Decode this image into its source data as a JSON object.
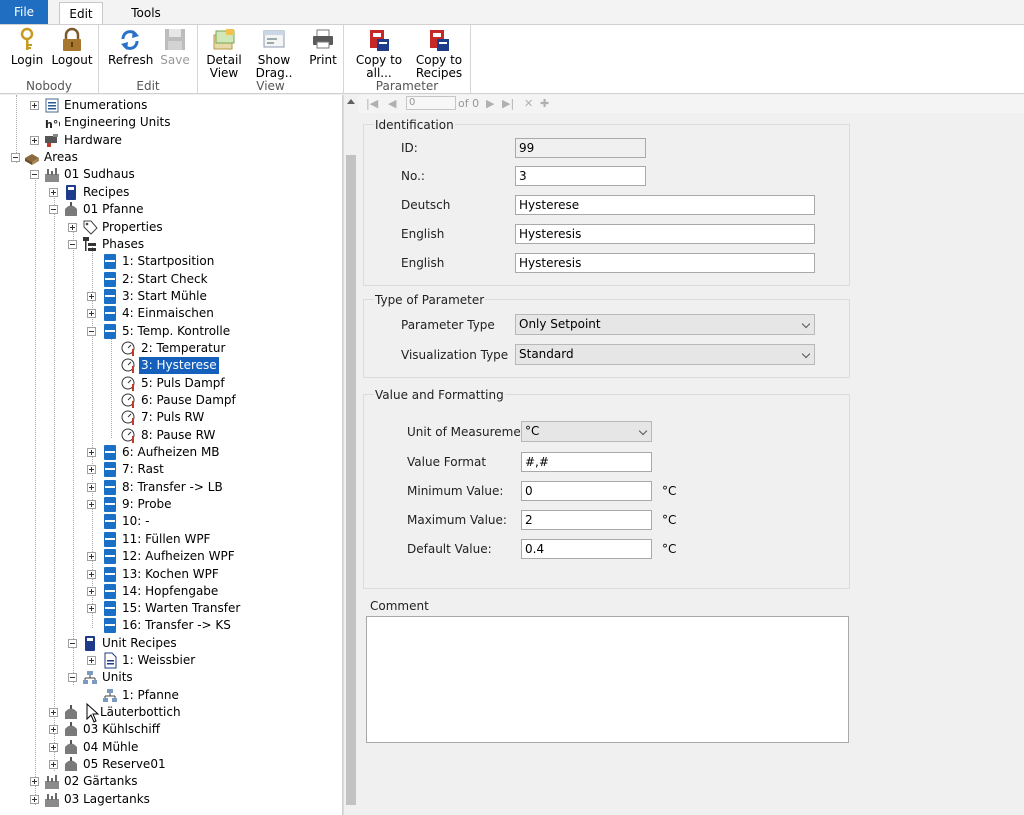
{
  "tabs": {
    "file": "File",
    "edit": "Edit",
    "tools": "Tools"
  },
  "ribbon": {
    "login": "Login",
    "logout": "Logout",
    "group_nobody": "Nobody",
    "refresh": "Refresh",
    "save": "Save",
    "group_edit": "Edit",
    "detail_line1": "Detail",
    "detail_line2": "View",
    "drag_line1": "Show",
    "drag_line2": "Drag..",
    "print": "Print",
    "group_view": "View",
    "copy_all_line1": "Copy to",
    "copy_all_line2": "all...",
    "copy_recipes_line1": "Copy to",
    "copy_recipes_line2": "Recipes",
    "group_parameter": "Parameter"
  },
  "tree": {
    "enumerations": "Enumerations",
    "engineering_units": "Engineering Units",
    "hardware": "Hardware",
    "areas": "Areas",
    "sudhaus": "01 Sudhaus",
    "recipes": "Recipes",
    "pfanne": "01 Pfanne",
    "properties": "Properties",
    "phases": "Phases",
    "phase_items": [
      "1: Startposition",
      "2: Start Check",
      "3: Start Mühle",
      "4: Einmaischen",
      "5: Temp. Kontrolle"
    ],
    "param_items": [
      "2: Temperatur",
      "3: Hysterese",
      "5: Puls Dampf",
      "6: Pause Dampf",
      "7: Puls RW",
      "8: Pause RW"
    ],
    "phase_items_2": [
      "6: Aufheizen MB",
      "7: Rast",
      "8: Transfer -> LB",
      "9: Probe",
      "10: -",
      "11: Füllen WPF",
      "12: Aufheizen WPF",
      "13: Kochen WPF",
      "14: Hopfengabe",
      "15: Warten Transfer",
      "16: Transfer -> KS"
    ],
    "unit_recipes": "Unit Recipes",
    "weissbier": "1: Weissbier",
    "units": "Units",
    "unit_pfanne": "1: Pfanne",
    "lauterbottich": "Läuterbottich",
    "kuhlschiff": "03 Kühlschiff",
    "muhle": "04 Mühle",
    "reserve": "05 Reserve01",
    "gartanks": "02 Gärtanks",
    "lagertanks": "03 Lagertanks"
  },
  "navigator": {
    "position": "0",
    "of_label": "of 0"
  },
  "identification": {
    "title": "Identification",
    "id_label": "ID:",
    "id_value": "99",
    "no_label": "No.:",
    "no_value": "3",
    "deutsch_label": "Deutsch",
    "deutsch_value": "Hysterese",
    "english_label": "English",
    "english_value": "Hysteresis",
    "english2_label": "English",
    "english2_value": "Hysteresis"
  },
  "type_of_parameter": {
    "title": "Type of Parameter",
    "param_type_label": "Parameter Type",
    "param_type_value": "Only Setpoint",
    "vis_type_label": "Visualization Type",
    "vis_type_value": "Standard"
  },
  "value_formatting": {
    "title": "Value and Formatting",
    "uom_label": "Unit of Measurement",
    "uom_value": "°C",
    "format_label": "Value Format",
    "format_value": "#,#",
    "min_label": "Minimum Value:",
    "min_value": "0",
    "max_label": "Maximum Value:",
    "max_value": "2",
    "default_label": "Default Value:",
    "default_value": "0.4",
    "unit_suffix": "°C"
  },
  "comment": {
    "title": "Comment",
    "value": ""
  },
  "colors": {
    "accent": "#1f6ec1",
    "selection": "#1560bd"
  }
}
